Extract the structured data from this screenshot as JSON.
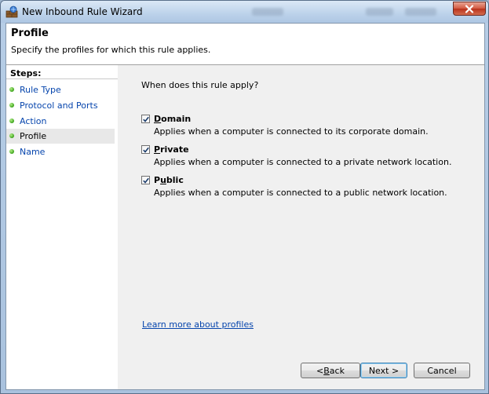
{
  "window": {
    "title": "New Inbound Rule Wizard",
    "close_icon": "close-icon"
  },
  "header": {
    "title": "Profile",
    "subtitle": "Specify the profiles for which this rule applies."
  },
  "sidebar": {
    "title": "Steps:",
    "items": [
      {
        "label": "Rule Type",
        "state": "done"
      },
      {
        "label": "Protocol and Ports",
        "state": "done"
      },
      {
        "label": "Action",
        "state": "done"
      },
      {
        "label": "Profile",
        "state": "current"
      },
      {
        "label": "Name",
        "state": "pending"
      }
    ]
  },
  "main": {
    "question": "When does this rule apply?",
    "options": [
      {
        "mnemonic": "D",
        "rest": "omain",
        "checked": true,
        "description": "Applies when a computer is connected to its corporate domain."
      },
      {
        "mnemonic": "P",
        "rest": "rivate",
        "checked": true,
        "description": "Applies when a computer is connected to a private network location."
      },
      {
        "prefix": "P",
        "mnemonic": "u",
        "rest": "blic",
        "checked": true,
        "description": "Applies when a computer is connected to a public network location."
      }
    ],
    "learn_more": "Learn more about profiles"
  },
  "buttons": {
    "back": {
      "prefix": "< ",
      "mnemonic": "B",
      "rest": "ack"
    },
    "next": "Next >",
    "cancel": "Cancel"
  },
  "colors": {
    "link": "#0645ad",
    "step_dot": "#3aa21a",
    "content_bg": "#f0f0f0"
  }
}
